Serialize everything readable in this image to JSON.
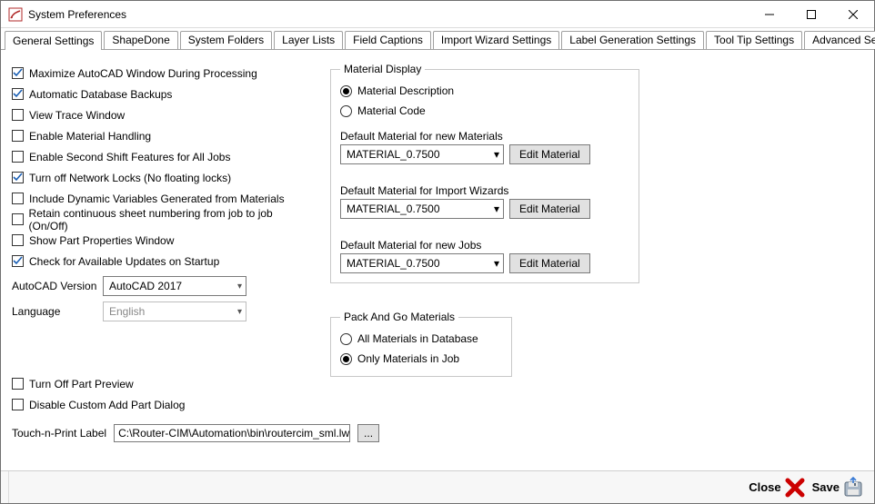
{
  "window": {
    "title": "System Preferences"
  },
  "tabs": [
    "General Settings",
    "ShapeDone",
    "System Folders",
    "Layer Lists",
    "Field Captions",
    "Import Wizard Settings",
    "Label Generation Settings",
    "Tool Tip Settings",
    "Advanced Settings"
  ],
  "checks": {
    "maximize": {
      "label": "Maximize AutoCAD Window During Processing",
      "checked": true
    },
    "backups": {
      "label": "Automatic Database Backups",
      "checked": true
    },
    "trace": {
      "label": "View Trace Window",
      "checked": false
    },
    "mathandling": {
      "label": "Enable Material Handling",
      "checked": false
    },
    "secondshift": {
      "label": "Enable Second Shift Features for All Jobs",
      "checked": false
    },
    "nofloat": {
      "label": "Turn off Network Locks (No floating locks)",
      "checked": true
    },
    "dynvars": {
      "label": "Include Dynamic Variables Generated from Materials",
      "checked": false
    },
    "sheetnum": {
      "label": "Retain continuous sheet numbering from job to job (On/Off)",
      "checked": false
    },
    "partprops": {
      "label": "Show Part Properties Window",
      "checked": false
    },
    "updates": {
      "label": "Check for Available Updates on Startup",
      "checked": true
    },
    "turnoffpreview": {
      "label": "Turn Off Part Preview",
      "checked": false
    },
    "disablecustomadd": {
      "label": "Disable Custom Add Part Dialog",
      "checked": false
    }
  },
  "autocad": {
    "label": "AutoCAD Version",
    "value": "AutoCAD 2017"
  },
  "language": {
    "label": "Language",
    "value": "English"
  },
  "touchnprint": {
    "label": "Touch-n-Print Label",
    "value": "C:\\Router-CIM\\Automation\\bin\\routercim_sml.lwl",
    "browse": "..."
  },
  "matdisplay": {
    "legend": "Material Display",
    "desc": "Material Description",
    "code": "Material Code",
    "selected": "desc",
    "defNewMatLabel": "Default Material for new Materials",
    "defImportLabel": "Default Material for Import Wizards",
    "defNewJobLabel": "Default Material for new Jobs",
    "matValue": "MATERIAL_0.7500",
    "editBtn": "Edit Material"
  },
  "packgo": {
    "legend": "Pack And Go Materials",
    "all": "All Materials in Database",
    "only": "Only Materials in Job",
    "selected": "only"
  },
  "footer": {
    "close": "Close",
    "save": "Save"
  }
}
